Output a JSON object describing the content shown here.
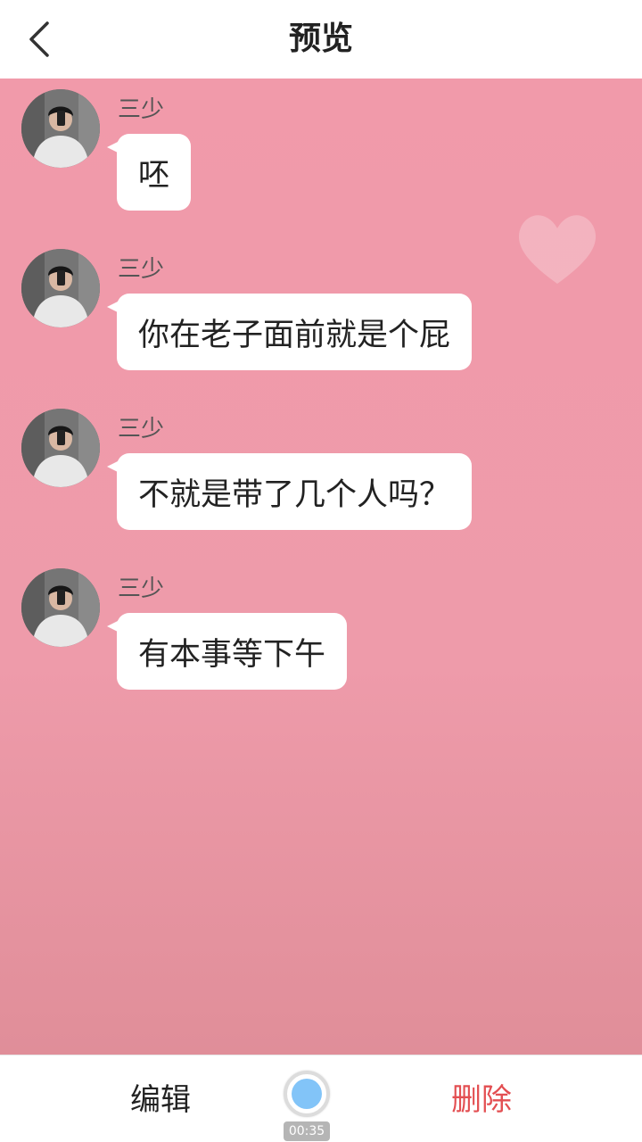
{
  "header": {
    "title": "预览",
    "back_icon": "chevron-left-icon"
  },
  "messages": [
    {
      "sender": "三少",
      "text": "呸"
    },
    {
      "sender": "三少",
      "text": "你在老子面前就是个屁"
    },
    {
      "sender": "三少",
      "text": "不就是带了几个人吗？"
    },
    {
      "sender": "三少",
      "text": "有本事等下午"
    }
  ],
  "footer": {
    "edit_label": "编辑",
    "delete_label": "删除",
    "record_timer": "00:35"
  },
  "colors": {
    "chat_background": "#f19aaa",
    "delete_accent": "#e34f52",
    "record_dot": "#82c4f8"
  }
}
